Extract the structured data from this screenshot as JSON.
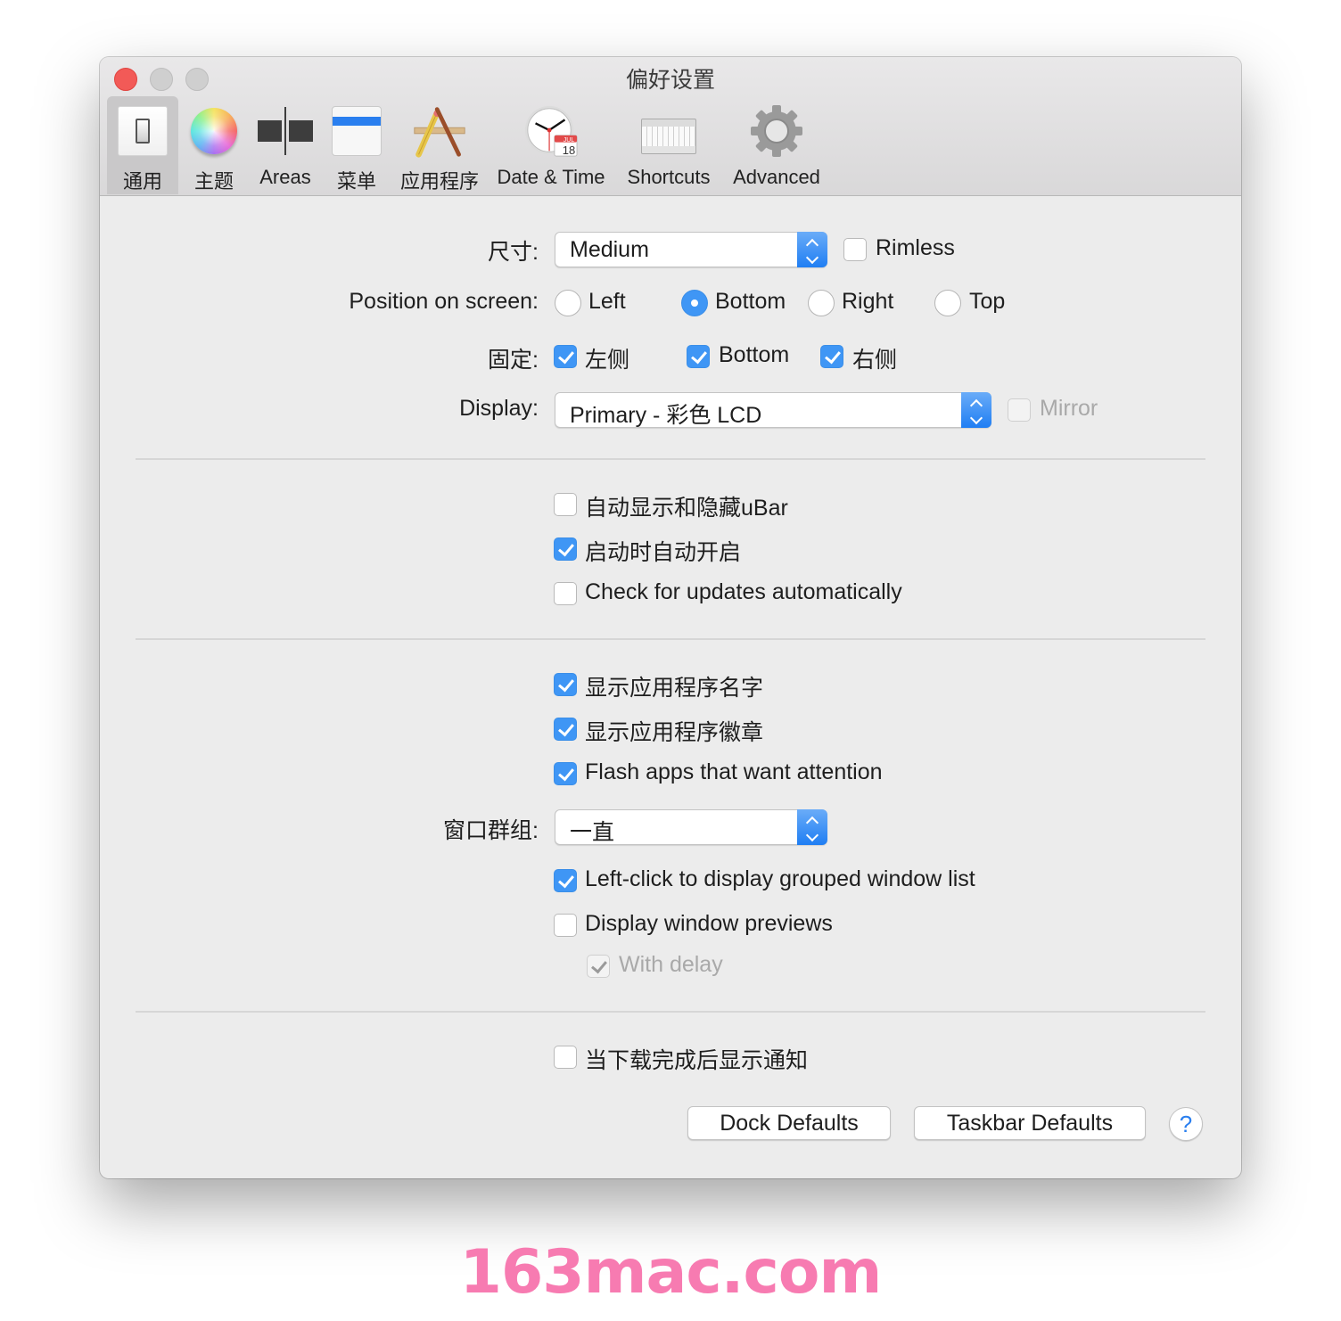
{
  "window": {
    "title": "偏好设置"
  },
  "toolbar": {
    "items": [
      {
        "label": "通用",
        "icon": "switch-icon",
        "active": true
      },
      {
        "label": "主题",
        "icon": "color-wheel-icon",
        "active": false
      },
      {
        "label": "Areas",
        "icon": "areas-icon",
        "active": false
      },
      {
        "label": "菜单",
        "icon": "menu-bar-icon",
        "active": false
      },
      {
        "label": "应用程序",
        "icon": "applications-icon",
        "active": false
      },
      {
        "label": "Date & Time",
        "icon": "clock-calendar-icon",
        "active": false
      },
      {
        "label": "Shortcuts",
        "icon": "keyboard-icon",
        "active": false
      },
      {
        "label": "Advanced",
        "icon": "gear-icon",
        "active": false
      }
    ],
    "calendar_month": "JUL",
    "calendar_day": "18"
  },
  "general": {
    "size": {
      "label": "尺寸:",
      "value": "Medium"
    },
    "rimless": {
      "label": "Rimless",
      "checked": false
    },
    "position": {
      "label": "Position on screen:",
      "options": [
        {
          "label": "Left",
          "selected": false
        },
        {
          "label": "Bottom",
          "selected": true
        },
        {
          "label": "Right",
          "selected": false
        },
        {
          "label": "Top",
          "selected": false
        }
      ]
    },
    "pin": {
      "label": "固定:",
      "options": [
        {
          "label": "左侧",
          "checked": true
        },
        {
          "label": "Bottom",
          "checked": true
        },
        {
          "label": "右侧",
          "checked": true
        }
      ]
    },
    "display": {
      "label": "Display:",
      "value": "Primary - 彩色 LCD"
    },
    "mirror": {
      "label": "Mirror",
      "checked": false,
      "disabled": true
    }
  },
  "behavior": {
    "auto_hide": {
      "label": "自动显示和隐藏uBar",
      "checked": false
    },
    "launch_at_login": {
      "label": "启动时自动开启",
      "checked": true
    },
    "check_updates": {
      "label": "Check for updates automatically",
      "checked": false
    }
  },
  "apps": {
    "show_app_names": {
      "label": "显示应用程序名字",
      "checked": true
    },
    "show_app_badges": {
      "label": "显示应用程序徽章",
      "checked": true
    },
    "flash_apps": {
      "label": "Flash apps that want attention",
      "checked": true
    },
    "window_grouping": {
      "label": "窗口群组:",
      "value": "一直"
    },
    "left_click_grouped": {
      "label": "Left-click to display grouped window list",
      "checked": true
    },
    "window_previews": {
      "label": "Display window previews",
      "checked": false
    },
    "with_delay": {
      "label": "With delay",
      "checked": true,
      "disabled": true
    }
  },
  "notifications": {
    "download_notify": {
      "label": "当下载完成后显示通知",
      "checked": false
    }
  },
  "footer": {
    "dock_defaults": "Dock Defaults",
    "taskbar_defaults": "Taskbar Defaults",
    "help": "?"
  },
  "watermark": "163mac.com",
  "colors": {
    "accent": "#3f96f5",
    "close": "#f25a57",
    "watermark": "#f77bb1"
  }
}
